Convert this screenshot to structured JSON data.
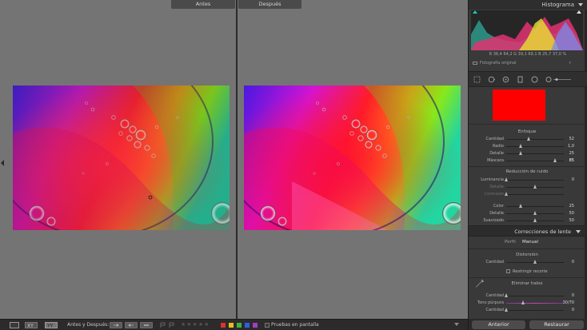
{
  "compare": {
    "before_label": "Antes",
    "after_label": "Después"
  },
  "histogram": {
    "title": "Histograma",
    "readout": "R 36,4 64,2  G 39,1 69,1  B 25,7 37,0 %",
    "original_photo": "Fotografía original"
  },
  "sharpening": {
    "title": "Enfoque",
    "rows": [
      {
        "label": "Cantidad",
        "value": "52",
        "level": 0.4
      },
      {
        "label": "Radio",
        "value": "1,0",
        "level": 0.25
      },
      {
        "label": "Detalle",
        "value": "25",
        "level": 0.25
      },
      {
        "label": "Máscara",
        "value": "85",
        "level": 0.85
      }
    ]
  },
  "noise_reduction": {
    "title": "Reducción de ruido",
    "rows": [
      {
        "label": "Luminancia",
        "value": "0",
        "level": 0.0
      },
      {
        "label": "Detalle",
        "value": "",
        "level": 0.5
      },
      {
        "label": "Contraste",
        "value": "",
        "level": 0.0
      },
      {
        "label": "Color",
        "value": "25",
        "level": 0.25
      },
      {
        "label": "Detalle",
        "value": "50",
        "level": 0.5
      },
      {
        "label": "Suavizado",
        "value": "50",
        "level": 0.5
      }
    ]
  },
  "lens": {
    "title": "Correcciones de lente",
    "tab_profile": "Perfil",
    "tab_manual": "Manual",
    "distortion_title": "Distorsión",
    "distortion_amount_label": "Cantidad",
    "distortion_amount_value": "0",
    "distortion_amount_level": 0.5,
    "restrict_crop": "Restringir recorte",
    "defringe_title": "Eliminar halos",
    "defringe_rows": [
      {
        "label": "Cantidad",
        "value": "0",
        "level": 0.0
      },
      {
        "label": "Tono púrpura",
        "value": "30/70",
        "level": 0.3
      },
      {
        "label": "Cantidad",
        "value": "0",
        "level": 0.0
      }
    ]
  },
  "panel_buttons": {
    "previous": "Anterior",
    "reset": "Restaurar"
  },
  "toolbar": {
    "before_after_label": "Antes y Después:",
    "soft_proofing": "Pruebas en pantalla",
    "color_labels": [
      "#e03030",
      "#e0c020",
      "#40b040",
      "#3060e0",
      "#a040c0"
    ]
  },
  "colors": {
    "mask_preview": "#ff0000"
  }
}
